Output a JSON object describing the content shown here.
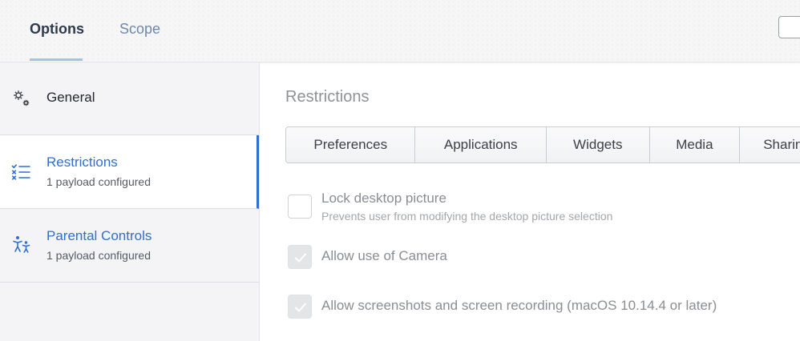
{
  "header": {
    "tabs": [
      {
        "label": "Options",
        "active": true
      },
      {
        "label": "Scope",
        "active": false
      }
    ]
  },
  "sidebar": {
    "items": [
      {
        "label": "General",
        "sub": "",
        "icon": "gears-icon"
      },
      {
        "label": "Restrictions",
        "sub": "1 payload configured",
        "icon": "checklist-icon",
        "selected": true
      },
      {
        "label": "Parental Controls",
        "sub": "1 payload configured",
        "icon": "parent-child-icon"
      }
    ]
  },
  "main": {
    "title": "Restrictions",
    "segments": [
      "Preferences",
      "Applications",
      "Widgets",
      "Media",
      "Sharing"
    ],
    "options": [
      {
        "label": "Lock desktop picture",
        "description": "Prevents user from modifying the desktop picture selection",
        "checked": false
      },
      {
        "label": "Allow use of Camera",
        "description": "",
        "checked": true
      },
      {
        "label": "Allow screenshots and screen recording (macOS 10.14.4 or later)",
        "description": "",
        "checked": true
      }
    ]
  },
  "colors": {
    "accent": "#2f6fd0",
    "sidebar_bg": "#f4f4f6",
    "tab_underline": "#a9c2e2"
  }
}
